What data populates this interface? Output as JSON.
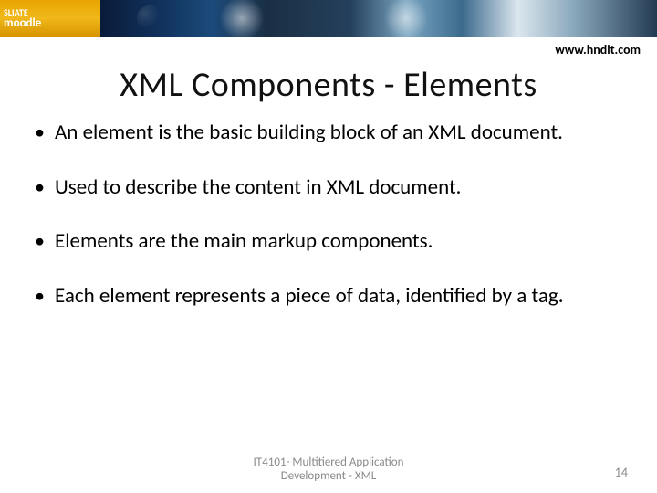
{
  "banner": {
    "logo_line1": "SLIATE",
    "logo_line2": "moodle"
  },
  "header": {
    "url": "www.hndit.com",
    "title": "XML Components - Elements"
  },
  "bullets": [
    "An element is the basic building block of an XML document.",
    "Used to describe the content in XML document.",
    "Elements are the main markup components.",
    "Each element represents a piece of data, identified by a tag."
  ],
  "footer": {
    "course_line1": "IT4101- Multitiered Application",
    "course_line2": "Development - XML",
    "page_number": "14"
  }
}
